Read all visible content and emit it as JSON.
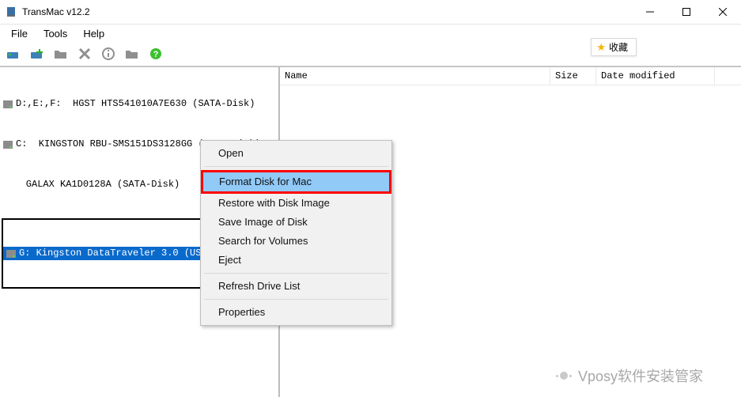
{
  "window": {
    "title": "TransMac v12.2"
  },
  "menubar": {
    "file": "File",
    "tools": "Tools",
    "help": "Help"
  },
  "fav_badge": {
    "text": "收藏"
  },
  "tree": {
    "drive0": "D:,E:,F:  HGST HTS541010A7E630 (SATA-Disk)",
    "drive1": "C:  KINGSTON RBU-SMS151DS3128GG (SATA-Disk)",
    "drive2": "    GALAX KA1D0128A (SATA-Disk)",
    "drive3": "G: Kingston DataTraveler 3.0 (USB-Disk)"
  },
  "columns": {
    "name": "Name",
    "size": "Size",
    "date": "Date modified"
  },
  "ctx": {
    "open": "Open",
    "format": "Format Disk for Mac",
    "restore": "Restore with Disk Image",
    "save": "Save Image of Disk",
    "search": "Search for Volumes",
    "eject": "Eject",
    "refresh": "Refresh Drive List",
    "properties": "Properties"
  },
  "watermark": {
    "text": "Vposy软件安装管家"
  }
}
